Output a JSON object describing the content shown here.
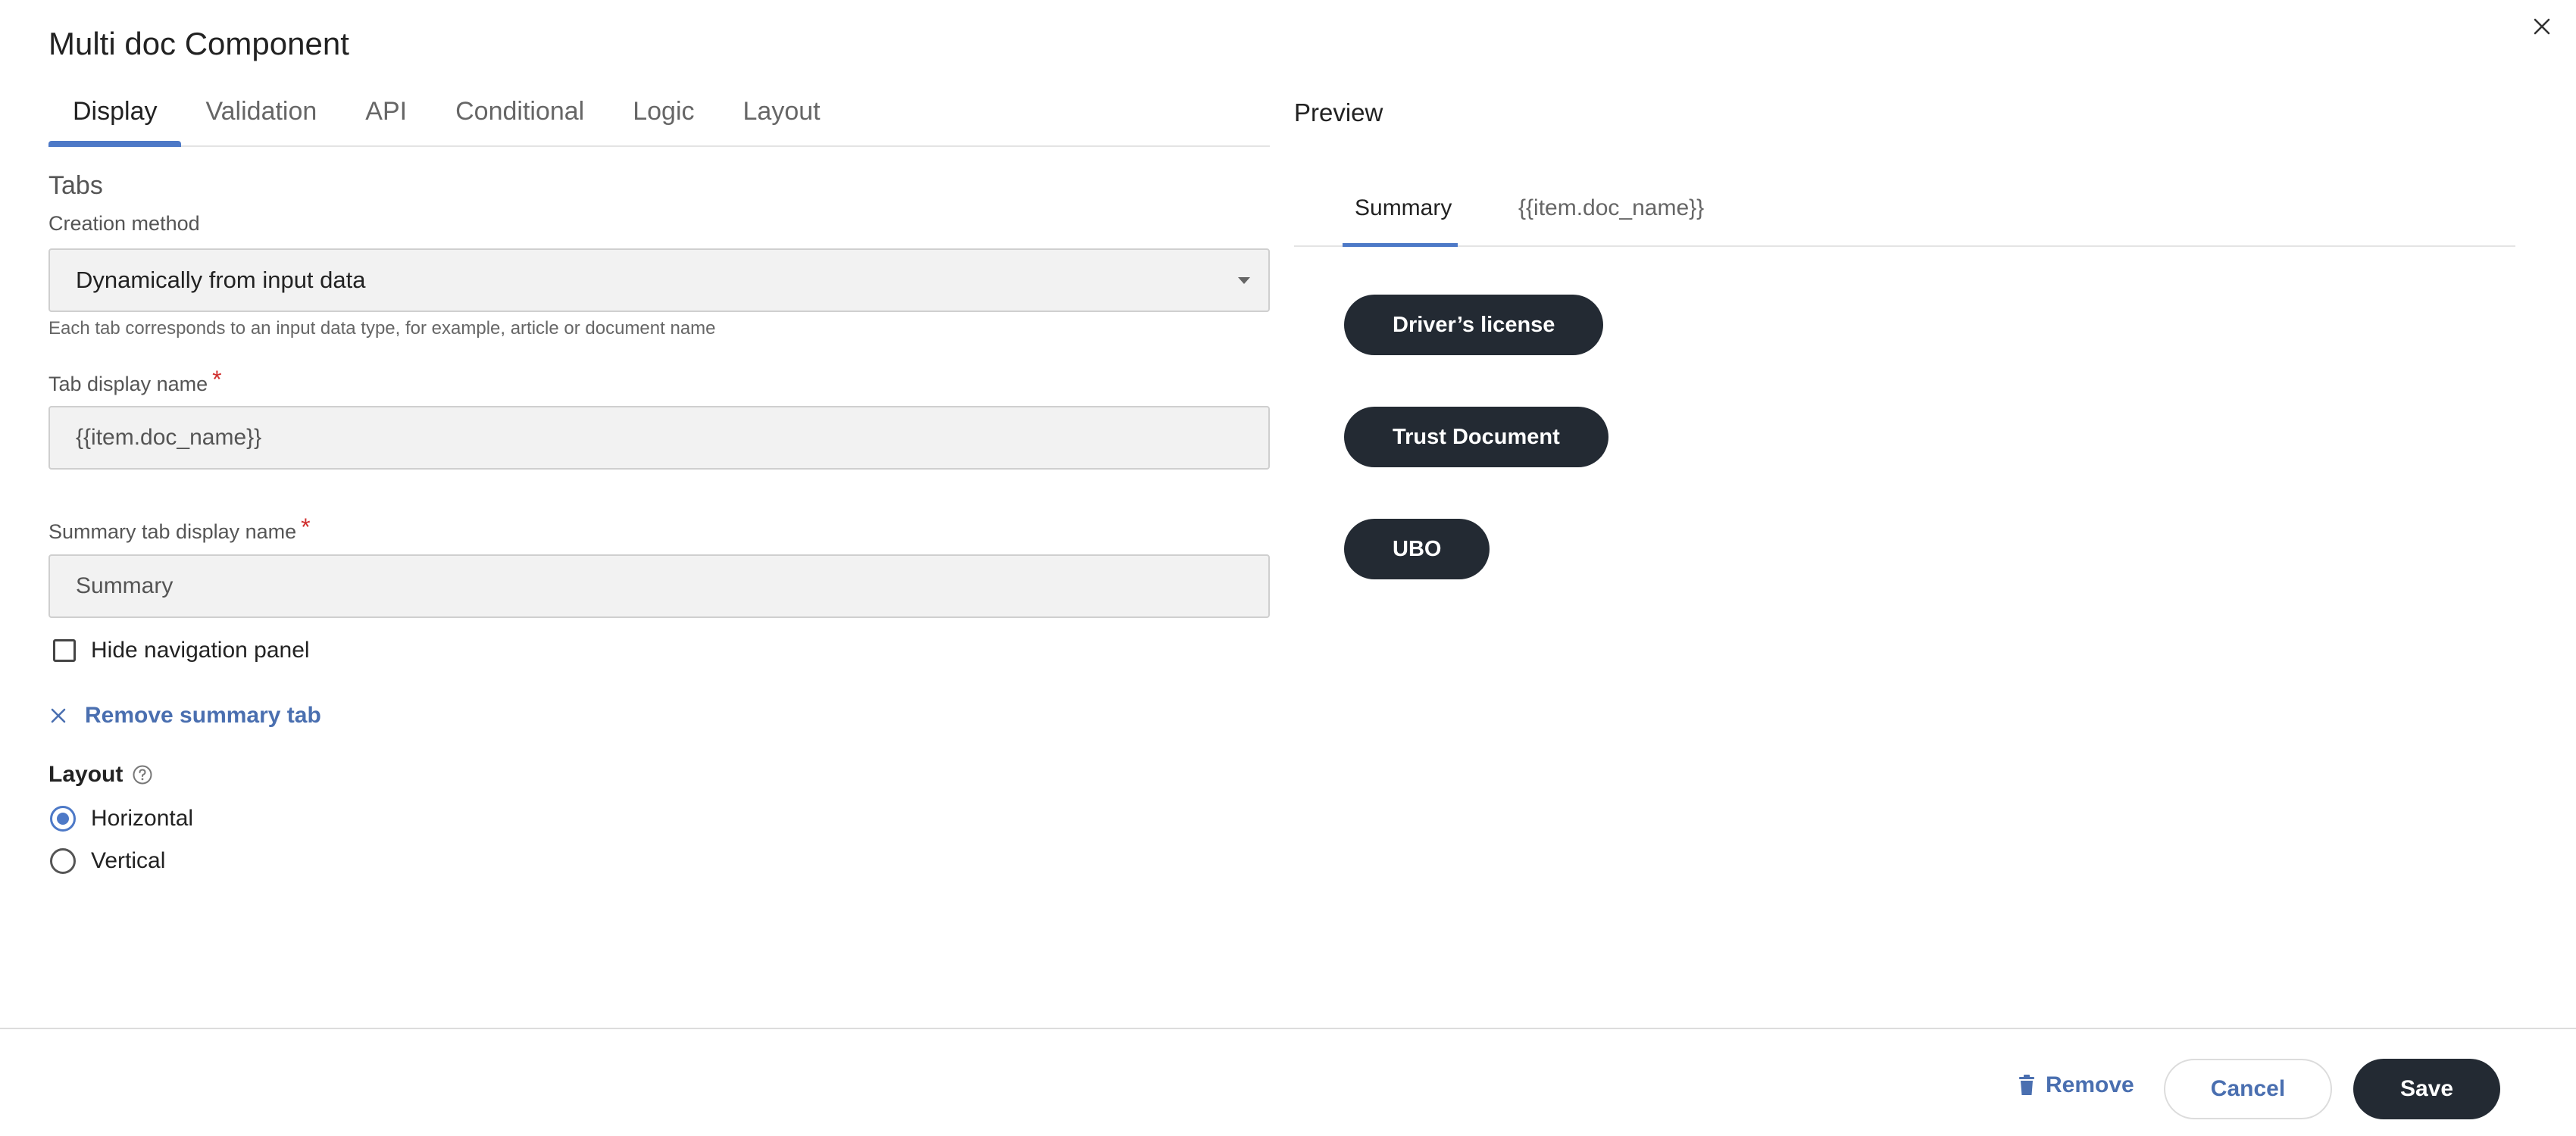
{
  "dialog": {
    "title": "Multi doc Component"
  },
  "tabs": [
    {
      "label": "Display",
      "active": true
    },
    {
      "label": "Validation",
      "active": false
    },
    {
      "label": "API",
      "active": false
    },
    {
      "label": "Conditional",
      "active": false
    },
    {
      "label": "Logic",
      "active": false
    },
    {
      "label": "Layout",
      "active": false
    }
  ],
  "form": {
    "section_label": "Tabs",
    "creation_method": {
      "label": "Creation method",
      "value": "Dynamically from input data",
      "help": "Each tab corresponds to an input data type, for example, article or document name"
    },
    "tab_display_name": {
      "label": "Tab display name",
      "required_mark": "*",
      "value": "{{item.doc_name}}"
    },
    "summary_tab_display_name": {
      "label": "Summary tab display name",
      "required_mark": "*",
      "value": "Summary"
    },
    "hide_navigation": {
      "label": "Hide navigation panel",
      "checked": false
    },
    "remove_summary_tab": {
      "label": "Remove summary tab"
    },
    "layout": {
      "label": "Layout",
      "options": [
        {
          "label": "Horizontal",
          "selected": true
        },
        {
          "label": "Vertical",
          "selected": false
        }
      ]
    }
  },
  "preview": {
    "title": "Preview",
    "tabs": [
      {
        "label": "Summary",
        "active": true
      },
      {
        "label": "{{item.doc_name}}",
        "active": false
      }
    ],
    "documents": [
      "Driver’s license",
      "Trust Document",
      "UBO"
    ]
  },
  "footer": {
    "remove_label": "Remove",
    "cancel_label": "Cancel",
    "save_label": "Save"
  },
  "colors": {
    "accent": "#4d79c7",
    "link": "#4a6fb0",
    "dark_button": "#232a33",
    "required": "#d0302f"
  },
  "icons": [
    "close-icon",
    "chevron-down-icon",
    "x-icon",
    "help-circle-icon",
    "trash-icon"
  ]
}
